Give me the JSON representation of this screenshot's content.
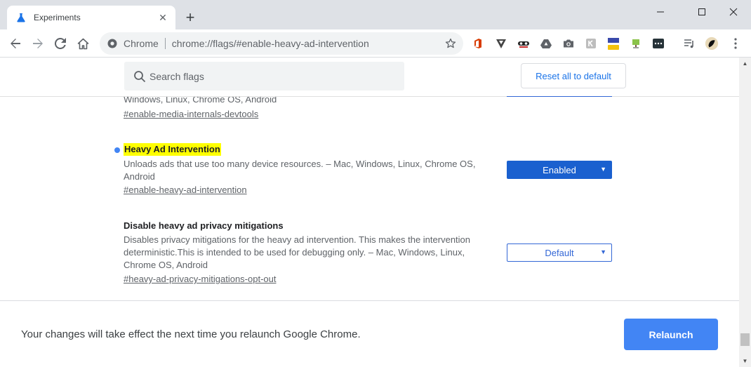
{
  "window": {
    "tab_title": "Experiments",
    "tab_close": "✕",
    "new_tab": "+"
  },
  "toolbar": {
    "site_label": "Chrome",
    "url": "chrome://flags/#enable-heavy-ad-intervention"
  },
  "flags_page": {
    "search_placeholder": "Search flags",
    "reset_label": "Reset all to default",
    "prev_flag": {
      "platforms": "Windows, Linux, Chrome OS, Android",
      "link": "#enable-media-internals-devtools"
    },
    "flags": [
      {
        "title": "Heavy Ad Intervention",
        "desc_line1": "Unloads ads that use too many device resources. – Mac, Windows, Linux, Chrome OS,",
        "desc_line2": "Android",
        "link": "#enable-heavy-ad-intervention",
        "selected": "Enabled",
        "modified": true
      },
      {
        "title": "Disable heavy ad privacy mitigations",
        "desc_line1": "Disables privacy mitigations for the heavy ad intervention. This makes the intervention",
        "desc_line2": "deterministic.This is intended to be used for debugging only. – Mac, Windows, Linux,",
        "desc_line3": "Chrome OS, Android",
        "link": "#heavy-ad-privacy-mitigations-opt-out",
        "selected": "Default",
        "modified": false
      }
    ]
  },
  "footer": {
    "message": "Your changes will take effect the next time you relaunch Google Chrome.",
    "relaunch_label": "Relaunch"
  },
  "colors": {
    "accent": "#1a73e8",
    "enabled_select": "#1a60cf",
    "relaunch": "#4285f4",
    "highlight": "#ffff00",
    "modified_dot": "#4285f4"
  },
  "icons": {
    "tab": "flask-icon",
    "back": "back-arrow-icon",
    "forward": "forward-arrow-icon",
    "reload": "reload-icon",
    "home": "home-icon",
    "site": "chrome-info-icon",
    "bookmark": "star-icon",
    "menu": "kebab-menu-icon"
  }
}
